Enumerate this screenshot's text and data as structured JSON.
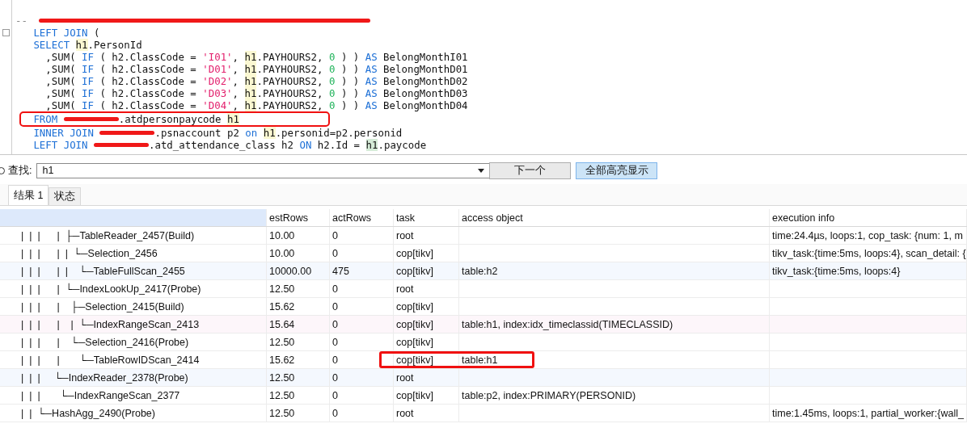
{
  "editor": {
    "lines": [
      {
        "boxed": false,
        "tokens": [
          {
            "kind": "comment",
            "text": "--"
          },
          {
            "kind": "redacted-line"
          }
        ]
      },
      {
        "boxed": false,
        "tokens": [
          {
            "kind": "kw",
            "text": "LEFT JOIN"
          },
          {
            "kind": "plain",
            "text": " ("
          }
        ]
      },
      {
        "boxed": false,
        "tokens": [
          {
            "kind": "kw",
            "text": "SELECT "
          },
          {
            "kind": "hl",
            "text": "h1"
          },
          {
            "kind": "plain",
            "text": ".PersonId"
          }
        ]
      },
      {
        "boxed": false,
        "tokens": [
          {
            "kind": "plain",
            "text": "  ,SUM( "
          },
          {
            "kind": "kw",
            "text": "IF"
          },
          {
            "kind": "plain",
            "text": " ( h2.ClassCode = "
          },
          {
            "kind": "str",
            "text": "'I01'"
          },
          {
            "kind": "plain",
            "text": ", "
          },
          {
            "kind": "hl",
            "text": "h1"
          },
          {
            "kind": "plain",
            "text": ".PAYHOURS2, "
          },
          {
            "kind": "num",
            "text": "0"
          },
          {
            "kind": "plain",
            "text": " ) ) "
          },
          {
            "kind": "kw",
            "text": "AS"
          },
          {
            "kind": "plain",
            "text": " BelongMonthI01"
          }
        ]
      },
      {
        "boxed": false,
        "tokens": [
          {
            "kind": "plain",
            "text": "  ,SUM( "
          },
          {
            "kind": "kw",
            "text": "IF"
          },
          {
            "kind": "plain",
            "text": " ( h2.ClassCode = "
          },
          {
            "kind": "str",
            "text": "'D01'"
          },
          {
            "kind": "plain",
            "text": ", "
          },
          {
            "kind": "hl",
            "text": "h1"
          },
          {
            "kind": "plain",
            "text": ".PAYHOURS2, "
          },
          {
            "kind": "num",
            "text": "0"
          },
          {
            "kind": "plain",
            "text": " ) ) "
          },
          {
            "kind": "kw",
            "text": "AS"
          },
          {
            "kind": "plain",
            "text": " BelongMonthD01"
          }
        ]
      },
      {
        "boxed": false,
        "tokens": [
          {
            "kind": "plain",
            "text": "  ,SUM( "
          },
          {
            "kind": "kw",
            "text": "IF"
          },
          {
            "kind": "plain",
            "text": " ( h2.ClassCode = "
          },
          {
            "kind": "str",
            "text": "'D02'"
          },
          {
            "kind": "plain",
            "text": ", "
          },
          {
            "kind": "hl",
            "text": "h1"
          },
          {
            "kind": "plain",
            "text": ".PAYHOURS2, "
          },
          {
            "kind": "num",
            "text": "0"
          },
          {
            "kind": "plain",
            "text": " ) ) "
          },
          {
            "kind": "kw",
            "text": "AS"
          },
          {
            "kind": "plain",
            "text": " BelongMonthD02"
          }
        ]
      },
      {
        "boxed": false,
        "tokens": [
          {
            "kind": "plain",
            "text": "  ,SUM( "
          },
          {
            "kind": "kw",
            "text": "IF"
          },
          {
            "kind": "plain",
            "text": " ( h2.ClassCode = "
          },
          {
            "kind": "str",
            "text": "'D03'"
          },
          {
            "kind": "plain",
            "text": ", "
          },
          {
            "kind": "hl",
            "text": "h1"
          },
          {
            "kind": "plain",
            "text": ".PAYHOURS2, "
          },
          {
            "kind": "num",
            "text": "0"
          },
          {
            "kind": "plain",
            "text": " ) ) "
          },
          {
            "kind": "kw",
            "text": "AS"
          },
          {
            "kind": "plain",
            "text": " BelongMonthD03"
          }
        ]
      },
      {
        "boxed": false,
        "tokens": [
          {
            "kind": "plain",
            "text": "  ,SUM( "
          },
          {
            "kind": "kw",
            "text": "IF"
          },
          {
            "kind": "plain",
            "text": " ( h2.ClassCode = "
          },
          {
            "kind": "str",
            "text": "'D04'"
          },
          {
            "kind": "plain",
            "text": ", "
          },
          {
            "kind": "hl",
            "text": "h1"
          },
          {
            "kind": "plain",
            "text": ".PAYHOURS2, "
          },
          {
            "kind": "num",
            "text": "0"
          },
          {
            "kind": "plain",
            "text": " ) ) "
          },
          {
            "kind": "kw",
            "text": "AS"
          },
          {
            "kind": "plain",
            "text": " BelongMonthD04"
          }
        ]
      },
      {
        "boxed": true,
        "tokens": [
          {
            "kind": "kw",
            "text": "FROM "
          },
          {
            "kind": "redacted"
          },
          {
            "kind": "plain",
            "text": ".atdpersonpaycode "
          },
          {
            "kind": "hl",
            "text": "h1"
          }
        ]
      },
      {
        "boxed": false,
        "tokens": [
          {
            "kind": "kw",
            "text": "INNER JOIN "
          },
          {
            "kind": "redacted"
          },
          {
            "kind": "plain",
            "text": ".psnaccount p2 "
          },
          {
            "kind": "kw",
            "text": "on "
          },
          {
            "kind": "hl",
            "text": "h1"
          },
          {
            "kind": "plain",
            "text": ".personid=p2.personid"
          }
        ]
      },
      {
        "boxed": false,
        "tokens": [
          {
            "kind": "kw",
            "text": "LEFT JOIN "
          },
          {
            "kind": "redacted"
          },
          {
            "kind": "plain",
            "text": ".atd_attendance_class h2 "
          },
          {
            "kind": "kw",
            "text": "ON"
          },
          {
            "kind": "plain",
            "text": " h2.Id = "
          },
          {
            "kind": "cur",
            "text": "h1"
          },
          {
            "kind": "plain",
            "text": ".paycode"
          }
        ]
      }
    ]
  },
  "find_bar": {
    "label": "查找:",
    "value": "h1",
    "buttons": [
      {
        "label": "下一个",
        "kind": "normal"
      },
      {
        "label": "全部高亮显示",
        "kind": "accent"
      }
    ]
  },
  "tabs": [
    {
      "label": "结果 1",
      "selected": true
    },
    {
      "label": "状态",
      "selected": false
    }
  ],
  "table": {
    "columns": [
      "estRows",
      "actRows",
      "task",
      "access object",
      "execution info"
    ],
    "rows": [
      {
        "id": "|  |  |      |  ├─TableReader_2457(Build)",
        "estRows": "10.00",
        "actRows": "0",
        "task": "root",
        "execution_info": "time:24.4µs, loops:1, cop_task: {num: 1, m",
        "boxed": false
      },
      {
        "id": "|  |  |      |  |  └─Selection_2456",
        "estRows": "10.00",
        "actRows": "0",
        "task": "cop[tikv]",
        "execution_info": "tikv_task:{time:5ms, loops:4}, scan_detail: {",
        "boxed": false
      },
      {
        "id": "|  |  |      |  |    └─TableFullScan_2455",
        "estRows": "10000.00",
        "actRows": "475",
        "task": "cop[tikv]",
        "access_object": "table:h2",
        "execution_info": "tikv_task:{time:5ms, loops:4}",
        "color": "#f4f8fe",
        "boxed": false
      },
      {
        "id": "|  |  |      |  └─IndexLookUp_2417(Probe)",
        "estRows": "12.50",
        "actRows": "0",
        "task": "root",
        "boxed": false
      },
      {
        "id": "|  |  |      |    ├─Selection_2415(Build)",
        "estRows": "15.62",
        "actRows": "0",
        "task": "cop[tikv]",
        "boxed": false
      },
      {
        "id": "|  |  |      |    |  └─IndexRangeScan_2413",
        "estRows": "15.64",
        "actRows": "0",
        "task": "cop[tikv]",
        "access_object": "table:h1, index:idx_timeclassid(TIMECLASSID)",
        "color": "#fdf6fa",
        "boxed": false
      },
      {
        "id": "|  |  |      |    └─Selection_2416(Probe)",
        "estRows": "12.50",
        "actRows": "0",
        "task": "cop[tikv]",
        "boxed": false
      },
      {
        "id": "|  |  |      |       └─TableRowIDScan_2414",
        "estRows": "15.62",
        "actRows": "0",
        "task": "cop[tikv]",
        "access_object": "table:h1",
        "boxed": true
      },
      {
        "id": "|  |  |     └─IndexReader_2378(Probe)",
        "estRows": "12.50",
        "actRows": "0",
        "task": "root",
        "color": "#f4f8fe",
        "boxed": false
      },
      {
        "id": "|  |  |       └─IndexRangeScan_2377",
        "estRows": "12.50",
        "actRows": "0",
        "task": "cop[tikv]",
        "access_object": "table:p2, index:PRIMARY(PERSONID)",
        "boxed": false
      },
      {
        "id": "|  |  └─HashAgg_2490(Probe)",
        "estRows": "12.50",
        "actRows": "0",
        "task": "root",
        "execution_info": "time:1.45ms, loops:1, partial_worker:{wall_",
        "boxed": false
      }
    ]
  }
}
